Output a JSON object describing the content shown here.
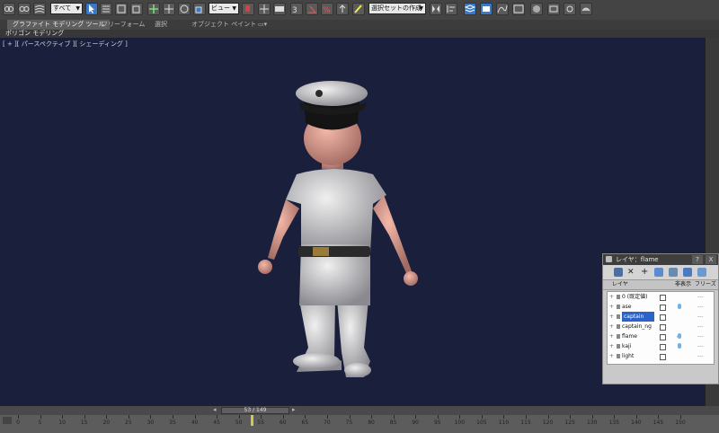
{
  "toolbar": {
    "selection_filter": "すべて",
    "ref_coord": "ビュー",
    "named_selection": "選択セットの作成"
  },
  "ribbon": {
    "tabs": [
      "グラファイト モデリング ツール",
      "フリーフォーム",
      "選択",
      "オブジェクト ペイント"
    ],
    "sub_tab": "ポリゴン モデリング"
  },
  "viewport": {
    "label": "[ + ][ パースペクティブ ][ シェーディング ]"
  },
  "layer_panel": {
    "title": "レイヤ：flame",
    "help_button": "?",
    "close_button": "X",
    "col_layer": "レイヤ",
    "col_hide": "非表示",
    "col_freeze": "フリーズ",
    "rows": [
      {
        "name": "0 (既定値)",
        "selected": false,
        "hidden_mark": "",
        "light": false
      },
      {
        "name": "ase",
        "selected": false,
        "hidden_mark": "",
        "light": true
      },
      {
        "name": "captain",
        "selected": true,
        "hidden_mark": "",
        "light": false
      },
      {
        "name": "captain_ng",
        "selected": false,
        "hidden_mark": "",
        "light": false
      },
      {
        "name": "flame",
        "selected": false,
        "hidden_mark": "✓",
        "light": true
      },
      {
        "name": "kaji",
        "selected": false,
        "hidden_mark": "",
        "light": true
      },
      {
        "name": "light",
        "selected": false,
        "hidden_mark": "",
        "light": false
      }
    ]
  },
  "timeline": {
    "frame_display": "53 / 149",
    "current_frame": 53,
    "ticks": [
      "0",
      "5",
      "10",
      "15",
      "20",
      "25",
      "30",
      "35",
      "40",
      "45",
      "50",
      "55",
      "60",
      "65",
      "70",
      "75",
      "80",
      "85",
      "90",
      "95",
      "100",
      "105",
      "110",
      "115",
      "120",
      "125",
      "130",
      "135",
      "140",
      "145",
      "150"
    ]
  },
  "colors": {
    "viewport_bg": "#1a203c",
    "selection_blue": "#2c63c8",
    "ui_dark": "#444444"
  }
}
